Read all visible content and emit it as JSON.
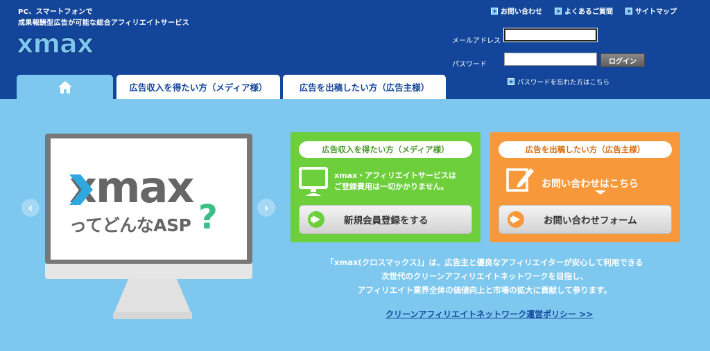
{
  "header": {
    "tagline_line1": "PC、スマートフォンで",
    "tagline_line2": "成果報酬型広告が可能な総合アフィリエイトサービス",
    "logo_text": "xmax",
    "util_links": [
      {
        "label": "お問い合わせ"
      },
      {
        "label": "よくあるご質問"
      },
      {
        "label": "サイトマップ"
      }
    ],
    "login": {
      "mail_label": "メールアドレス",
      "password_label": "パスワード",
      "mail_value": "",
      "password_value": "",
      "button_label": "ログイン",
      "forgot_label": "パスワードを忘れた方はこちら"
    }
  },
  "tabs": [
    {
      "label": "",
      "icon": "home-icon"
    },
    {
      "label": "広告収入を得たい方（メディア様）"
    },
    {
      "label": "広告を出稿したい方（広告主様）"
    }
  ],
  "hero": {
    "logo_text": "xmax",
    "caption": "ってどんなASP",
    "question_mark": "?"
  },
  "media_panel": {
    "heading": "広告収入を得たい方（メディア様）",
    "text_line1": "xmax・アフィリエイトサービスは",
    "text_line2": "ご登録費用は一切かかりません。",
    "button_label": "新規会員登録をする",
    "icon": "monitor-icon"
  },
  "advertiser_panel": {
    "heading": "広告を出稿したい方（広告主様）",
    "text": "お問い合わせはこちら",
    "button_label": "お問い合わせフォーム",
    "icon": "pencil-icon"
  },
  "intro": {
    "line1": "「xmax(クロスマックス)」は、広告主と優良なアフィリエイターが安心して利用できる",
    "line2": "次世代のクリーンアフィリエイトネットワークを目指し、",
    "line3": "アフィリエイト業界全体の価値向上と市場の拡大に貢献して参ります。"
  },
  "policy_link": "クリーンアフィリエイトネットワーク運営ポリシー >>",
  "colors": {
    "header_bg": "#13469a",
    "page_bg": "#7ec8ef",
    "green": "#6ccf3b",
    "orange": "#f7993b"
  }
}
